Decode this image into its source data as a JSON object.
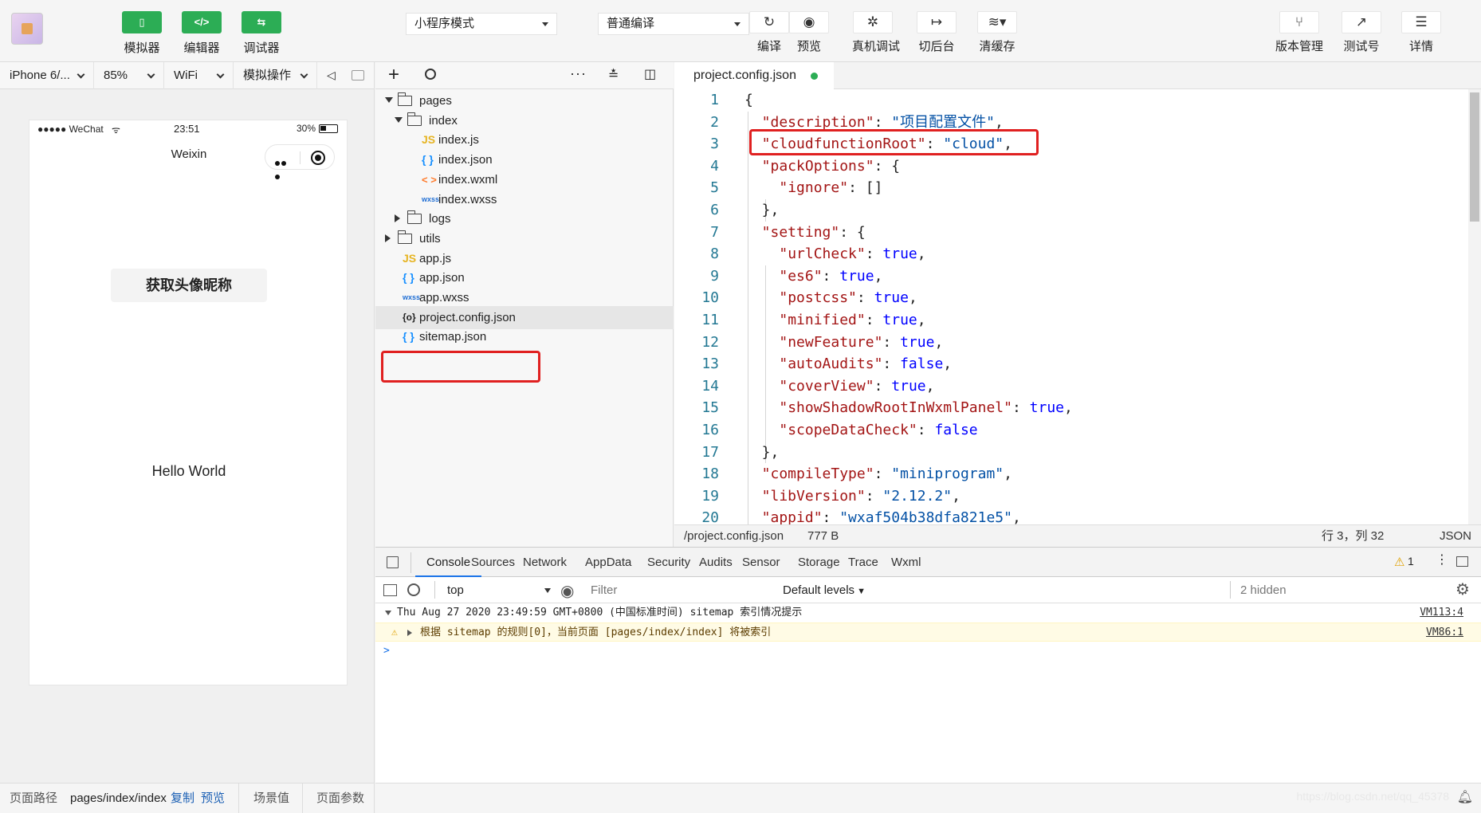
{
  "toolbar": {
    "mode_buttons": [
      {
        "label": "模拟器",
        "icon": "phone-icon"
      },
      {
        "label": "编辑器",
        "icon": "code-icon"
      },
      {
        "label": "调试器",
        "icon": "toggles-icon"
      }
    ],
    "mode_select": "小程序模式",
    "compile_select": "普通编译",
    "actions": [
      {
        "label": "编译",
        "icon": "refresh-icon"
      },
      {
        "label": "预览",
        "icon": "eye-icon"
      },
      {
        "label": "真机调试",
        "icon": "bug-icon"
      },
      {
        "label": "切后台",
        "icon": "background-icon"
      },
      {
        "label": "清缓存",
        "icon": "layers-icon"
      }
    ],
    "right_actions": [
      {
        "label": "版本管理",
        "icon": "branch-icon"
      },
      {
        "label": "测试号",
        "icon": "external-link-icon"
      },
      {
        "label": "详情",
        "icon": "menu-icon"
      }
    ]
  },
  "simulator": {
    "device": "iPhone 6/...",
    "zoom": "85%",
    "network": "WiFi",
    "operation": "模拟操作",
    "status_signal": "●●●●● WeChat",
    "status_time": "23:51",
    "status_battery": "30%",
    "nav_title": "Weixin",
    "button_label": "获取头像昵称",
    "hello_text": "Hello World",
    "footer": {
      "path_label": "页面路径",
      "path_value": "pages/index/index",
      "copy": "复制",
      "preview": "预览",
      "scene": "场景值",
      "params": "页面参数"
    }
  },
  "file_tree": [
    {
      "name": "pages",
      "type": "folder",
      "open": true,
      "depth": 0
    },
    {
      "name": "index",
      "type": "folder",
      "open": true,
      "depth": 1
    },
    {
      "name": "index.js",
      "type": "js",
      "depth": 2
    },
    {
      "name": "index.json",
      "type": "json",
      "depth": 2
    },
    {
      "name": "index.wxml",
      "type": "wxml",
      "depth": 2
    },
    {
      "name": "index.wxss",
      "type": "wxss",
      "depth": 2
    },
    {
      "name": "logs",
      "type": "folder",
      "open": false,
      "depth": 1
    },
    {
      "name": "utils",
      "type": "folder",
      "open": false,
      "depth": 0
    },
    {
      "name": "app.js",
      "type": "js",
      "depth": 0
    },
    {
      "name": "app.json",
      "type": "json",
      "depth": 0
    },
    {
      "name": "app.wxss",
      "type": "wxss",
      "depth": 0
    },
    {
      "name": "project.config.json",
      "type": "config",
      "depth": 0,
      "selected": true
    },
    {
      "name": "sitemap.json",
      "type": "json",
      "depth": 0
    }
  ],
  "icon_glyphs": {
    "js": "JS",
    "json": "{ }",
    "wxml": "< >",
    "wxss": "wxss",
    "config": "{o}"
  },
  "editor": {
    "tab_label": "project.config.json",
    "lines": [
      {
        "n": "1",
        "indent": 0,
        "parts": [
          [
            "p",
            "{"
          ]
        ]
      },
      {
        "n": "2",
        "indent": 1,
        "parts": [
          [
            "k",
            "\"description\""
          ],
          [
            "p",
            ": "
          ],
          [
            "s",
            "\"项目配置文件\""
          ],
          [
            "p",
            ","
          ]
        ]
      },
      {
        "n": "3",
        "indent": 1,
        "parts": [
          [
            "k",
            "\"cloudfunctionRoot\""
          ],
          [
            "p",
            ": "
          ],
          [
            "s",
            "\"cloud\""
          ],
          [
            "p",
            ","
          ]
        ]
      },
      {
        "n": "4",
        "indent": 1,
        "parts": [
          [
            "k",
            "\"packOptions\""
          ],
          [
            "p",
            ": {"
          ]
        ]
      },
      {
        "n": "5",
        "indent": 2,
        "parts": [
          [
            "k",
            "\"ignore\""
          ],
          [
            "p",
            ": []"
          ]
        ]
      },
      {
        "n": "6",
        "indent": 1,
        "parts": [
          [
            "p",
            "},"
          ]
        ]
      },
      {
        "n": "7",
        "indent": 1,
        "parts": [
          [
            "k",
            "\"setting\""
          ],
          [
            "p",
            ": {"
          ]
        ]
      },
      {
        "n": "8",
        "indent": 2,
        "parts": [
          [
            "k",
            "\"urlCheck\""
          ],
          [
            "p",
            ": "
          ],
          [
            "b",
            "true"
          ],
          [
            "p",
            ","
          ]
        ]
      },
      {
        "n": "9",
        "indent": 2,
        "parts": [
          [
            "k",
            "\"es6\""
          ],
          [
            "p",
            ": "
          ],
          [
            "b",
            "true"
          ],
          [
            "p",
            ","
          ]
        ]
      },
      {
        "n": "10",
        "indent": 2,
        "parts": [
          [
            "k",
            "\"postcss\""
          ],
          [
            "p",
            ": "
          ],
          [
            "b",
            "true"
          ],
          [
            "p",
            ","
          ]
        ]
      },
      {
        "n": "11",
        "indent": 2,
        "parts": [
          [
            "k",
            "\"minified\""
          ],
          [
            "p",
            ": "
          ],
          [
            "b",
            "true"
          ],
          [
            "p",
            ","
          ]
        ]
      },
      {
        "n": "12",
        "indent": 2,
        "parts": [
          [
            "k",
            "\"newFeature\""
          ],
          [
            "p",
            ": "
          ],
          [
            "b",
            "true"
          ],
          [
            "p",
            ","
          ]
        ]
      },
      {
        "n": "13",
        "indent": 2,
        "parts": [
          [
            "k",
            "\"autoAudits\""
          ],
          [
            "p",
            ": "
          ],
          [
            "b",
            "false"
          ],
          [
            "p",
            ","
          ]
        ]
      },
      {
        "n": "14",
        "indent": 2,
        "parts": [
          [
            "k",
            "\"coverView\""
          ],
          [
            "p",
            ": "
          ],
          [
            "b",
            "true"
          ],
          [
            "p",
            ","
          ]
        ]
      },
      {
        "n": "15",
        "indent": 2,
        "parts": [
          [
            "k",
            "\"showShadowRootInWxmlPanel\""
          ],
          [
            "p",
            ": "
          ],
          [
            "b",
            "true"
          ],
          [
            "p",
            ","
          ]
        ]
      },
      {
        "n": "16",
        "indent": 2,
        "parts": [
          [
            "k",
            "\"scopeDataCheck\""
          ],
          [
            "p",
            ": "
          ],
          [
            "b",
            "false"
          ]
        ]
      },
      {
        "n": "17",
        "indent": 1,
        "parts": [
          [
            "p",
            "},"
          ]
        ]
      },
      {
        "n": "18",
        "indent": 1,
        "parts": [
          [
            "k",
            "\"compileType\""
          ],
          [
            "p",
            ": "
          ],
          [
            "s",
            "\"miniprogram\""
          ],
          [
            "p",
            ","
          ]
        ]
      },
      {
        "n": "19",
        "indent": 1,
        "parts": [
          [
            "k",
            "\"libVersion\""
          ],
          [
            "p",
            ": "
          ],
          [
            "s",
            "\"2.12.2\""
          ],
          [
            "p",
            ","
          ]
        ]
      },
      {
        "n": "20",
        "indent": 1,
        "parts": [
          [
            "k",
            "\"appid\""
          ],
          [
            "p",
            ": "
          ],
          [
            "s",
            "\"wxaf504b38dfa821e5\""
          ],
          [
            "p",
            ","
          ]
        ]
      }
    ],
    "status": {
      "path": "/project.config.json",
      "size": "777 B",
      "cursor": "行 3，列 32",
      "language": "JSON"
    }
  },
  "devtools": {
    "tabs": [
      "Console",
      "Sources",
      "Network",
      "AppData",
      "Security",
      "Audits",
      "Sensor",
      "Storage",
      "Trace",
      "Wxml"
    ],
    "active_tab": "Console",
    "warning_count": "1",
    "context": "top",
    "filter_placeholder": "Filter",
    "levels": "Default levels",
    "hidden": "2 hidden",
    "log_header": "Thu Aug 27 2020 23:49:59 GMT+0800 (中国标准时间) sitemap 索引情况提示",
    "log_header_link": "VM113:4",
    "warning_text": "根据 sitemap 的规则[0]，当前页面 [pages/index/index] 将被索引",
    "warning_link": "VM86:1",
    "prompt": ">"
  },
  "watermark": "https://blog.csdn.net/qq_45378"
}
